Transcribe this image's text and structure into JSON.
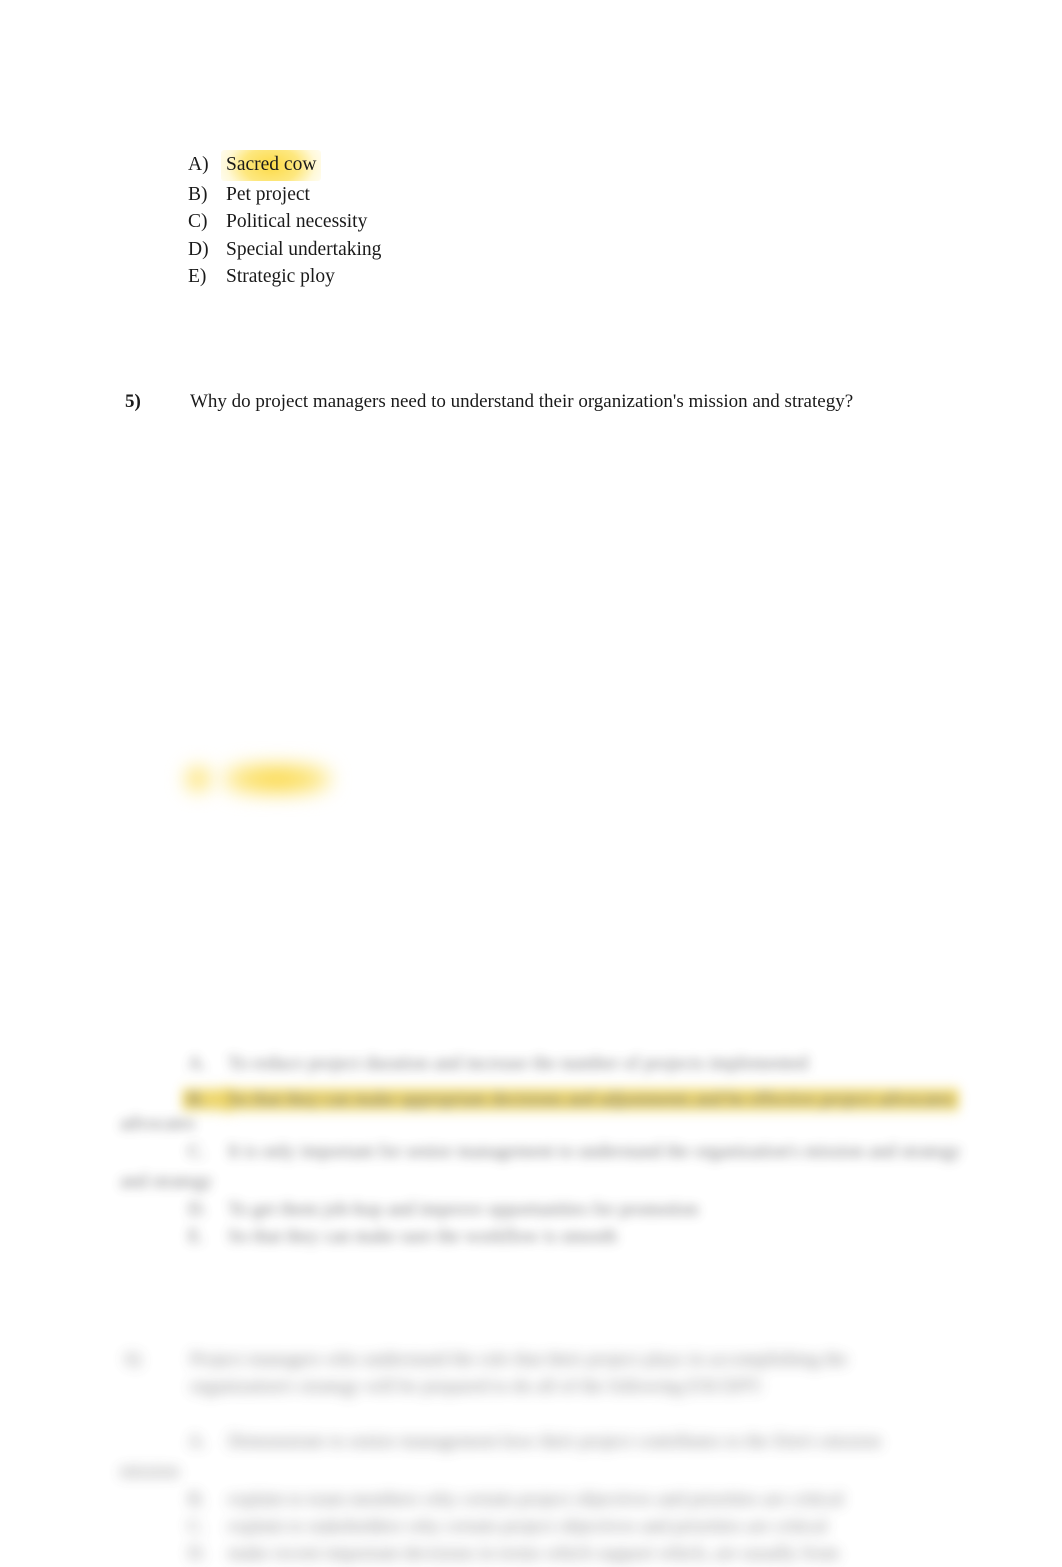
{
  "document": {
    "type": "exam-question-sheet",
    "background_color": "#ffffff",
    "text_color": "#1a1a1a",
    "highlight_color": "#fcd83c",
    "blur_text_color": "#59595c"
  },
  "answer_options_top": {
    "name": "question-4-answer-options",
    "legible": true,
    "options": [
      {
        "letter": "A)",
        "label": "Sacred cow",
        "highlighted": true
      },
      {
        "letter": "B)",
        "label": "Pet project",
        "highlighted": false
      },
      {
        "letter": "C)",
        "label": "Political necessity",
        "highlighted": false
      },
      {
        "letter": "D)",
        "label": " Special undertaking",
        "highlighted": false
      },
      {
        "letter": "E)",
        "label": "Strategic ploy",
        "highlighted": false
      }
    ]
  },
  "question_5": {
    "name": "question-5",
    "number": "5)",
    "text": "Why do project managers need to understand their organization's mission and strategy?",
    "legible": true
  },
  "obscured": {
    "note": "Lower page content is visually blurred in the source screenshot and is not legible.",
    "smear_highlight": {
      "name": "obscured-highlight-smear",
      "color": "#fad63e"
    },
    "answer_block_5": {
      "name": "question-5-answer-options-blurred",
      "lines": [
        {
          "letter": "A.",
          "text": "To reduce project duration and increase the number of projects implemented",
          "highlighted": false
        },
        {
          "letter": "B.",
          "text": "So that they can make appropriate decisions and adjustments and be effective project advocates",
          "highlighted": true,
          "wrap": "advocates"
        },
        {
          "letter": "C.",
          "text": "It is only important for senior management to understand the organization's mission and strategy",
          "highlighted": false,
          "wrap": "and strategy"
        },
        {
          "letter": "D.",
          "text": "To get them job-hop and improve opportunities for promotion",
          "highlighted": false
        },
        {
          "letter": "E.",
          "text": "So that they can make sure the workflow is smooth",
          "highlighted": false
        }
      ]
    },
    "question_6": {
      "name": "question-6-blurred",
      "number": "6)",
      "text": "Project managers who understand the role that their project plays in accomplishing the organization's strategy will be prepared to do all of the following EXCEPT:",
      "lines": [
        {
          "letter": "A.",
          "text": "Demonstrate to senior management how their project contributes to the firm's mission",
          "wrap": "mission"
        },
        {
          "letter": "B.",
          "text": "explain to team members why certain project objectives and priorities are critical"
        },
        {
          "letter": "C.",
          "text": "explain to stakeholders why certain project objectives and priorities are critical"
        },
        {
          "letter": "D.",
          "text": "make recent important decisions in terms which support which, are usually from"
        }
      ]
    }
  }
}
